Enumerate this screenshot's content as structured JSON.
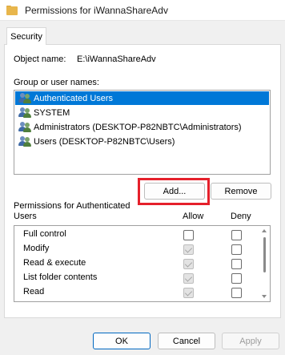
{
  "window": {
    "title": "Permissions for iWannaShareAdv",
    "title_icon": "folder-icon"
  },
  "tabs": [
    {
      "label": "Security",
      "active": true
    }
  ],
  "object": {
    "label": "Object name:",
    "value": "E:\\iWannaShareAdv"
  },
  "groups": {
    "label": "Group or user names:",
    "items": [
      {
        "label": "Authenticated Users",
        "selected": true,
        "icon": "user-group-icon"
      },
      {
        "label": "SYSTEM",
        "selected": false,
        "icon": "user-group-icon"
      },
      {
        "label": "Administrators (DESKTOP-P82NBTC\\Administrators)",
        "selected": false,
        "icon": "user-group-icon"
      },
      {
        "label": "Users (DESKTOP-P82NBTC\\Users)",
        "selected": false,
        "icon": "user-group-icon"
      }
    ]
  },
  "buttons": {
    "add": "Add...",
    "remove": "Remove",
    "ok": "OK",
    "cancel": "Cancel",
    "apply": "Apply"
  },
  "permissions": {
    "header_line1": "Permissions for Authenticated",
    "header_line2": "Users",
    "allow_header": "Allow",
    "deny_header": "Deny",
    "rows": [
      {
        "label": "Full control",
        "allow": false,
        "allow_inherited": false,
        "deny": false
      },
      {
        "label": "Modify",
        "allow": true,
        "allow_inherited": true,
        "deny": false
      },
      {
        "label": "Read & execute",
        "allow": true,
        "allow_inherited": true,
        "deny": false
      },
      {
        "label": "List folder contents",
        "allow": true,
        "allow_inherited": true,
        "deny": false
      },
      {
        "label": "Read",
        "allow": true,
        "allow_inherited": true,
        "deny": false
      }
    ]
  },
  "colors": {
    "selection": "#0078d7",
    "highlight_box": "#e5202b",
    "primary_border": "#0067c0"
  }
}
